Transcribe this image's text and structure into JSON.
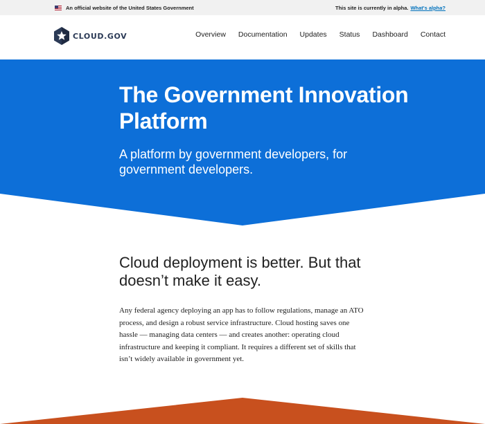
{
  "gov_banner": {
    "official_text": "An official website of the United States Government",
    "alpha_text": "This site is currently in alpha.",
    "alpha_link": "What's alpha?"
  },
  "header": {
    "logo_text": "CLOUD.GOV",
    "nav": [
      "Overview",
      "Documentation",
      "Updates",
      "Status",
      "Dashboard",
      "Contact"
    ]
  },
  "hero": {
    "title": "The Government Innovation Platform",
    "subtitle": "A platform by government developers, for government developers."
  },
  "intro": {
    "heading": "Cloud deployment is better. But that doesn’t make it easy.",
    "body": "Any federal agency deploying an app has to follow regulations, manage an ATO process, and design a robust service infrastructure. Cloud hosting saves one hassle — managing data centers — and creates another: operating cloud infrastructure and keeping it compliant. It requires a different set of skills that isn’t widely available in government yet."
  },
  "colors": {
    "hero_blue": "#0d6fd8",
    "accent_orange": "#c8501e",
    "logo_navy": "#2b3a56",
    "link_blue": "#0071bc"
  }
}
